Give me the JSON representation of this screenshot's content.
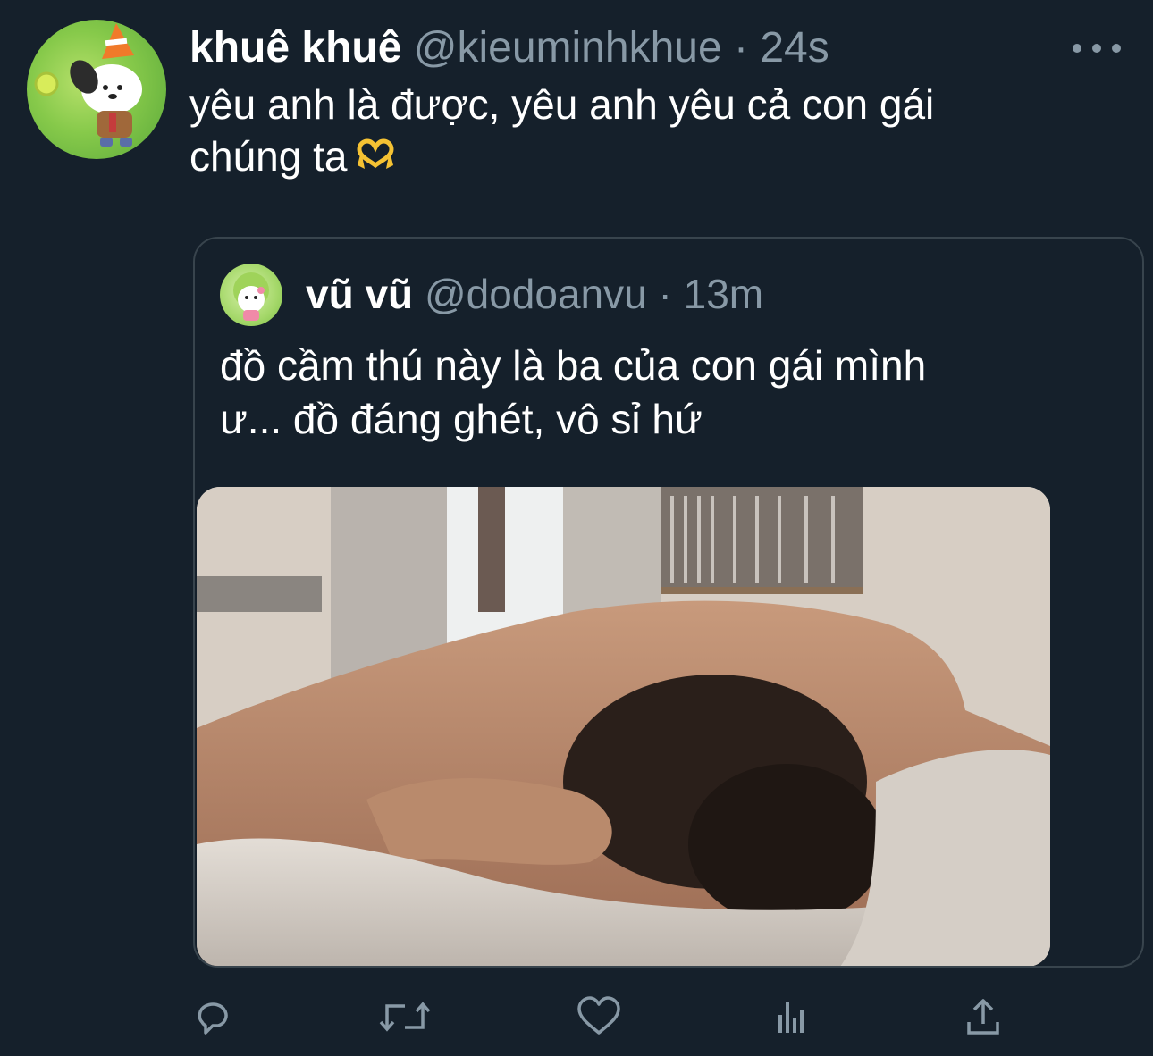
{
  "tweet": {
    "display_name": "khuê khuê",
    "handle": "@kieuminhkhue",
    "separator": "·",
    "time": "24s",
    "text_line1": "yêu anh là được, yêu anh yêu cả con gái",
    "text_line2": "chúng ta",
    "emoji": "heart-hands-emoji"
  },
  "quoted": {
    "display_name": "vũ vũ",
    "handle": "@dodoanvu",
    "separator": "·",
    "time": "13m",
    "text_line1": "đồ cầm thú này là ba của con gái mình",
    "text_line2": "ư... đồ đáng ghét, vô sỉ hứ",
    "image": "photo-person-lying-in-bed"
  },
  "actions": [
    "reply-icon",
    "retweet-icon",
    "like-icon",
    "analytics-icon",
    "share-icon"
  ],
  "colors": {
    "background": "#15202b",
    "secondary_text": "#8899a6",
    "border": "#38444d",
    "text": "#ffffff"
  }
}
